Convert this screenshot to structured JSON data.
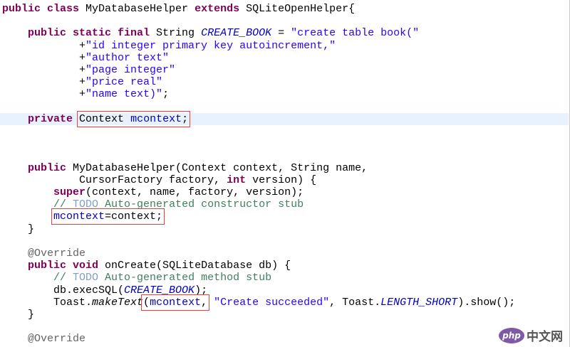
{
  "watermark": {
    "logo": "php",
    "text": "中文网"
  },
  "lines": [
    {
      "n": 0,
      "tokens": [
        {
          "t": "public class",
          "c": "kw"
        },
        {
          "t": " MyDatabaseHelper "
        },
        {
          "t": "extends",
          "c": "kw"
        },
        {
          "t": " SQLiteOpenHelper{"
        }
      ]
    },
    {
      "n": 2,
      "tokens": [
        {
          "t": "    "
        },
        {
          "t": "public static final",
          "c": "kw"
        },
        {
          "t": " String "
        },
        {
          "t": "CREATE_BOOK",
          "c": "sf"
        },
        {
          "t": " = "
        },
        {
          "t": "\"create table book(\"",
          "c": "str"
        }
      ]
    },
    {
      "n": 3,
      "tokens": [
        {
          "t": "            +"
        },
        {
          "t": "\"id integer primary key autoincrement,\"",
          "c": "str"
        }
      ]
    },
    {
      "n": 4,
      "tokens": [
        {
          "t": "            +"
        },
        {
          "t": "\"author text\"",
          "c": "str"
        }
      ]
    },
    {
      "n": 5,
      "tokens": [
        {
          "t": "            +"
        },
        {
          "t": "\"page integer\"",
          "c": "str"
        }
      ]
    },
    {
      "n": 6,
      "tokens": [
        {
          "t": "            +"
        },
        {
          "t": "\"price real\"",
          "c": "str"
        }
      ]
    },
    {
      "n": 7,
      "tokens": [
        {
          "t": "            +"
        },
        {
          "t": "\"name text)\"",
          "c": "str"
        },
        {
          "t": ";"
        }
      ]
    },
    {
      "n": 9,
      "hl": true,
      "tokens": [
        {
          "t": "    "
        },
        {
          "t": "private",
          "c": "kw"
        },
        {
          "t": " "
        },
        {
          "t": "Context mcontext;",
          "c": "box",
          "sub": [
            {
              "t": "Context "
            },
            {
              "t": "mcontext",
              "c": "fld"
            },
            {
              "t": ";"
            }
          ]
        }
      ]
    },
    {
      "n": 13,
      "tokens": [
        {
          "t": "    "
        },
        {
          "t": "public",
          "c": "kw"
        },
        {
          "t": " MyDatabaseHelper(Context context, String name,"
        }
      ]
    },
    {
      "n": 14,
      "tokens": [
        {
          "t": "            CursorFactory factory, "
        },
        {
          "t": "int",
          "c": "kw"
        },
        {
          "t": " version) {"
        }
      ]
    },
    {
      "n": 15,
      "tokens": [
        {
          "t": "        "
        },
        {
          "t": "super",
          "c": "kw"
        },
        {
          "t": "(context, name, factory, version);"
        }
      ]
    },
    {
      "n": 16,
      "tokens": [
        {
          "t": "        "
        },
        {
          "t": "// ",
          "c": "cm"
        },
        {
          "t": "TODO",
          "c": "todo"
        },
        {
          "t": " Auto-generated constructor stub",
          "c": "cm"
        }
      ]
    },
    {
      "n": 17,
      "tokens": [
        {
          "t": "        "
        },
        {
          "t": "mcontext=context;",
          "c": "box",
          "sub": [
            {
              "t": "mcontext",
              "c": "fld"
            },
            {
              "t": "=context;"
            }
          ]
        }
      ]
    },
    {
      "n": 18,
      "tokens": [
        {
          "t": "    }"
        }
      ]
    },
    {
      "n": 20,
      "tokens": [
        {
          "t": "    "
        },
        {
          "t": "@Override",
          "c": "ann"
        }
      ]
    },
    {
      "n": 21,
      "tokens": [
        {
          "t": "    "
        },
        {
          "t": "public void",
          "c": "kw"
        },
        {
          "t": " onCreate(SQLiteDatabase db) {"
        }
      ]
    },
    {
      "n": 22,
      "tokens": [
        {
          "t": "        "
        },
        {
          "t": "// ",
          "c": "cm"
        },
        {
          "t": "TODO",
          "c": "todo"
        },
        {
          "t": " Auto-generated method stub",
          "c": "cm"
        }
      ]
    },
    {
      "n": 23,
      "tokens": [
        {
          "t": "        db.execSQL("
        },
        {
          "t": "CREATE_BOOK",
          "c": "sf"
        },
        {
          "t": ");"
        }
      ]
    },
    {
      "n": 24,
      "tokens": [
        {
          "t": "        Toast."
        },
        {
          "t": "makeText",
          "c": "it"
        },
        {
          "t": "(mcontext,",
          "c": "box",
          "sub": [
            {
              "t": "("
            },
            {
              "t": "mcontext",
              "c": "fld"
            },
            {
              "t": ","
            }
          ]
        },
        {
          "t": " "
        },
        {
          "t": "\"Create succeeded\"",
          "c": "str"
        },
        {
          "t": ", Toast."
        },
        {
          "t": "LENGTH_SHORT",
          "c": "sf"
        },
        {
          "t": ").show();"
        }
      ]
    },
    {
      "n": 25,
      "tokens": [
        {
          "t": "    }"
        }
      ]
    },
    {
      "n": 27,
      "tokens": [
        {
          "t": "    "
        },
        {
          "t": "@Override",
          "c": "ann"
        }
      ]
    }
  ]
}
